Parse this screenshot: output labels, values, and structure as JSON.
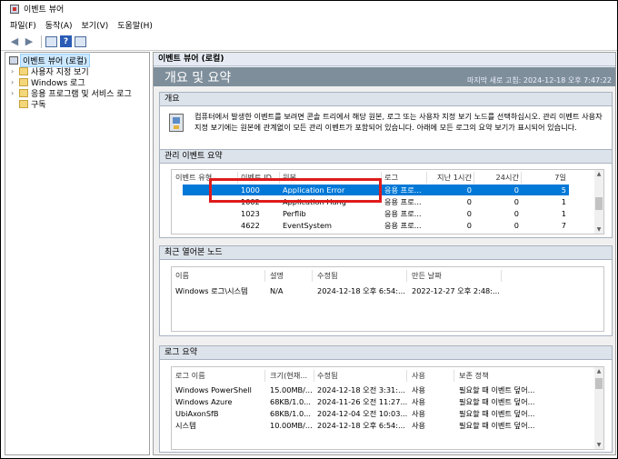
{
  "window": {
    "title": "이벤트 뷰어"
  },
  "menu": [
    "파일(F)",
    "동작(A)",
    "보기(V)",
    "도움말(H)"
  ],
  "toolbar": {
    "help_label": "?"
  },
  "tree": {
    "items": [
      {
        "label": "이벤트 뷰어 (로컬)",
        "arrow": ""
      },
      {
        "label": "사용자 지정 보기",
        "arrow": "›"
      },
      {
        "label": "Windows 로그",
        "arrow": "›"
      },
      {
        "label": "응용 프로그램 및 서비스 로그",
        "arrow": "›"
      },
      {
        "label": "구독",
        "arrow": ""
      }
    ]
  },
  "main": {
    "header": "이벤트 뷰어 (로컬)",
    "banner_title": "개요 및 요약",
    "last_refresh": "마지막 새로 고침: 2024-12-18 오후 7:47:22"
  },
  "overview": {
    "title": "개요",
    "text": "컴퓨터에서 발생한 이벤트를 보려면 콘솔 트리에서 해당 원본, 로그 또는 사용자 지정 보기 노드를 선택하십시오. 관리 이벤트 사용자 지정 보기에는 원본에 관계없이 모든 관리 이벤트가 포함되어 있습니다. 아래에 모든 로그의 요약 보기가 표시되어 있습니다."
  },
  "admin_events": {
    "title": "관리 이벤트 요약",
    "columns": [
      "이벤트 유형",
      "이벤트 ID",
      "원본",
      "로그",
      "지난 1시간",
      "24시간",
      "7일"
    ],
    "rows": [
      [
        "",
        "1000",
        "Application Error",
        "응용 프로...",
        "0",
        "0",
        "5"
      ],
      [
        "",
        "1002",
        "Application Hang",
        "응용 프로...",
        "0",
        "0",
        "1"
      ],
      [
        "",
        "1023",
        "Perflib",
        "응용 프로...",
        "0",
        "0",
        "1"
      ],
      [
        "",
        "4622",
        "EventSystem",
        "응용 프로...",
        "0",
        "0",
        "7"
      ]
    ]
  },
  "recent_nodes": {
    "title": "최근 열어본 노드",
    "columns": [
      "이름",
      "설명",
      "수정됨",
      "만든 날짜"
    ],
    "rows": [
      [
        "Windows 로그\\시스템",
        "N/A",
        "2024-12-18 오후 6:54:...",
        "2022-12-27 오후 2:48:..."
      ]
    ]
  },
  "log_summary": {
    "title": "로그 요약",
    "columns": [
      "로그 이름",
      "크기(현재...",
      "수정됨",
      "사용",
      "보존 정책"
    ],
    "rows": [
      [
        "Windows PowerShell",
        "15.00MB/...",
        "2024-12-18 오전 3:31:...",
        "사용",
        "필요할 때 이벤트 덮어..."
      ],
      [
        "Windows Azure",
        "68KB/1.0...",
        "2024-11-26 오전 11:27...",
        "사용",
        "필요할 때 이벤트 덮어..."
      ],
      [
        "UbiAxonSfB",
        "68KB/1.0...",
        "2024-12-04 오전 10:03...",
        "사용",
        "필요할 때 이벤트 덮어..."
      ],
      [
        "시스템",
        "10.00MB/...",
        "2024-12-18 오후 6:54:...",
        "사용",
        "필요할 때 이벤트 덮어..."
      ]
    ]
  },
  "colors": {
    "selection": "#0078d7",
    "highlight_box": "#e01b1b",
    "banner": "#7e8f9b"
  }
}
